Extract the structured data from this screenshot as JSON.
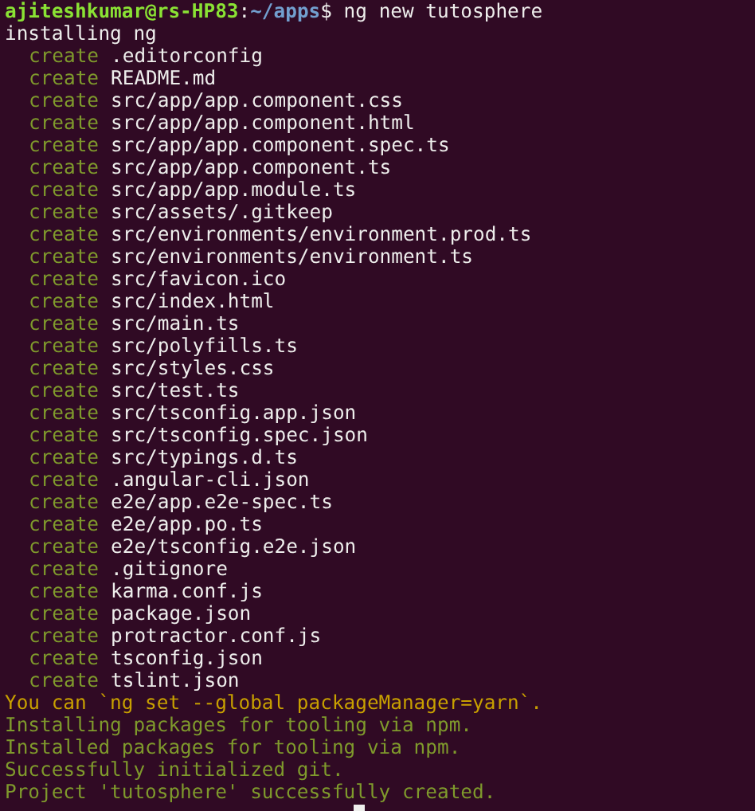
{
  "prompt": {
    "user_host": "ajiteshkumar@rs-HP83",
    "separator": ":",
    "path": "~/apps",
    "symbol": "$",
    "command": " ng new tutosphere"
  },
  "lines": [
    {
      "kind": "plain",
      "text": "installing ng"
    },
    {
      "kind": "create",
      "verb": "create",
      "path": ".editorconfig"
    },
    {
      "kind": "create",
      "verb": "create",
      "path": "README.md"
    },
    {
      "kind": "create",
      "verb": "create",
      "path": "src/app/app.component.css"
    },
    {
      "kind": "create",
      "verb": "create",
      "path": "src/app/app.component.html"
    },
    {
      "kind": "create",
      "verb": "create",
      "path": "src/app/app.component.spec.ts"
    },
    {
      "kind": "create",
      "verb": "create",
      "path": "src/app/app.component.ts"
    },
    {
      "kind": "create",
      "verb": "create",
      "path": "src/app/app.module.ts"
    },
    {
      "kind": "create",
      "verb": "create",
      "path": "src/assets/.gitkeep"
    },
    {
      "kind": "create",
      "verb": "create",
      "path": "src/environments/environment.prod.ts"
    },
    {
      "kind": "create",
      "verb": "create",
      "path": "src/environments/environment.ts"
    },
    {
      "kind": "create",
      "verb": "create",
      "path": "src/favicon.ico"
    },
    {
      "kind": "create",
      "verb": "create",
      "path": "src/index.html"
    },
    {
      "kind": "create",
      "verb": "create",
      "path": "src/main.ts"
    },
    {
      "kind": "create",
      "verb": "create",
      "path": "src/polyfills.ts"
    },
    {
      "kind": "create",
      "verb": "create",
      "path": "src/styles.css"
    },
    {
      "kind": "create",
      "verb": "create",
      "path": "src/test.ts"
    },
    {
      "kind": "create",
      "verb": "create",
      "path": "src/tsconfig.app.json"
    },
    {
      "kind": "create",
      "verb": "create",
      "path": "src/tsconfig.spec.json"
    },
    {
      "kind": "create",
      "verb": "create",
      "path": "src/typings.d.ts"
    },
    {
      "kind": "create",
      "verb": "create",
      "path": ".angular-cli.json"
    },
    {
      "kind": "create",
      "verb": "create",
      "path": "e2e/app.e2e-spec.ts"
    },
    {
      "kind": "create",
      "verb": "create",
      "path": "e2e/app.po.ts"
    },
    {
      "kind": "create",
      "verb": "create",
      "path": "e2e/tsconfig.e2e.json"
    },
    {
      "kind": "create",
      "verb": "create",
      "path": ".gitignore"
    },
    {
      "kind": "create",
      "verb": "create",
      "path": "karma.conf.js"
    },
    {
      "kind": "create",
      "verb": "create",
      "path": "package.json"
    },
    {
      "kind": "create",
      "verb": "create",
      "path": "protractor.conf.js"
    },
    {
      "kind": "create",
      "verb": "create",
      "path": "tsconfig.json"
    },
    {
      "kind": "create",
      "verb": "create",
      "path": "tslint.json"
    },
    {
      "kind": "warning",
      "text": "You can `ng set --global packageManager=yarn`."
    },
    {
      "kind": "success",
      "text": "Installing packages for tooling via npm."
    },
    {
      "kind": "success",
      "text": "Installed packages for tooling via npm."
    },
    {
      "kind": "success",
      "text": "Successfully initialized git."
    },
    {
      "kind": "success",
      "text": "Project 'tutosphere' successfully created."
    }
  ],
  "cursor": {
    "visible": true
  }
}
